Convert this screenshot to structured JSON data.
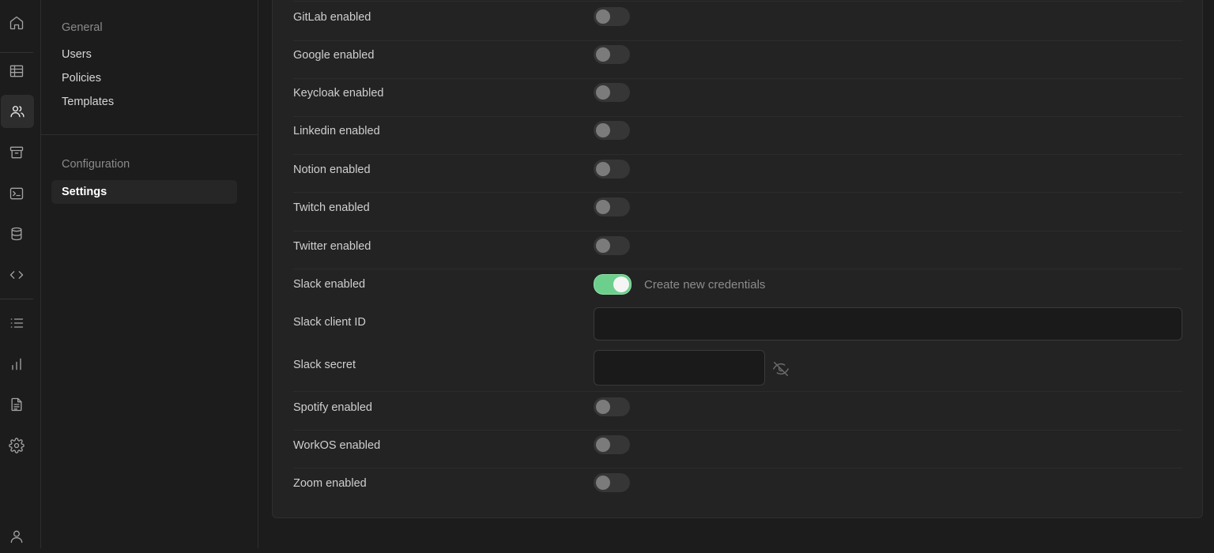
{
  "rail": {
    "icons": [
      "home-icon",
      "table-icon",
      "users-icon",
      "archive-icon",
      "terminal-icon",
      "database-icon",
      "code-icon",
      "list-icon",
      "bar-chart-icon",
      "document-icon",
      "gear-icon",
      "user-icon"
    ],
    "active": "users-icon"
  },
  "nav": {
    "section1_heading": "General",
    "items1": [
      "Users",
      "Policies",
      "Templates"
    ],
    "section2_heading": "Configuration",
    "active_item": "Settings"
  },
  "providers": [
    {
      "label": "GitLab enabled",
      "enabled": false
    },
    {
      "label": "Google enabled",
      "enabled": false
    },
    {
      "label": "Keycloak enabled",
      "enabled": false
    },
    {
      "label": "Linkedin enabled",
      "enabled": false
    },
    {
      "label": "Notion enabled",
      "enabled": false
    },
    {
      "label": "Twitch enabled",
      "enabled": false
    },
    {
      "label": "Twitter enabled",
      "enabled": false
    },
    {
      "label": "Slack enabled",
      "enabled": true,
      "description": "Create new credentials"
    },
    {
      "label": "Spotify enabled",
      "enabled": false
    },
    {
      "label": "WorkOS enabled",
      "enabled": false
    },
    {
      "label": "Zoom enabled",
      "enabled": false
    }
  ],
  "slack": {
    "client_id_label": "Slack client ID",
    "client_id_value": "",
    "secret_label": "Slack secret",
    "secret_value": ""
  },
  "colors": {
    "toggle_on": "#6ccf8c",
    "toggle_off": "#363636",
    "background": "#1c1c1c",
    "panel": "#232323"
  }
}
